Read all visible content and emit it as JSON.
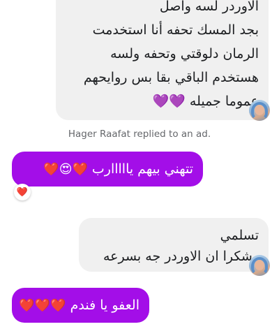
{
  "messages": [
    {
      "direction": "incoming",
      "lines": [
        "الاوردر لسه واصل",
        "بجد المسك تحفه أنا استخدمت",
        "الرمان دلوقتي وتحفه ولسه",
        "هستخدم الباقي بقا بس روايحهم",
        "عموما جميله"
      ],
      "trailing_emoji": "💜💜"
    },
    {
      "direction": "outgoing",
      "text": "تتهني بيهم يااااارب",
      "emoji": "❤️😍❤️",
      "reaction": "❤️"
    },
    {
      "direction": "incoming",
      "lines": [
        "تسلمي",
        "وشكرا ان الاوردر جه بسرعه"
      ]
    },
    {
      "direction": "outgoing",
      "text": "العفو يا فندم",
      "emoji": "❤️❤️❤️"
    }
  ],
  "meta_notice": "Hager Raafat replied to an ad.",
  "colors": {
    "outgoing_bubble": "#a30ee8",
    "incoming_bubble": "#f0f0f0",
    "meta_text": "#65676b"
  }
}
